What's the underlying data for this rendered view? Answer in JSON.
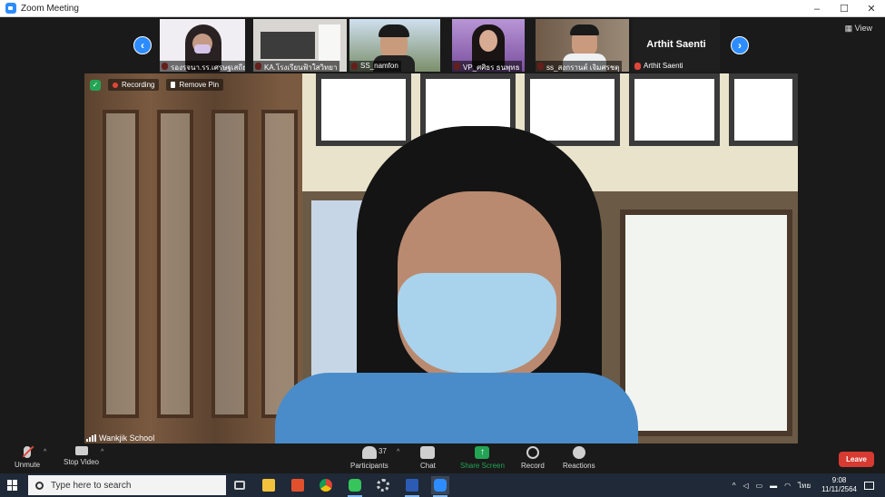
{
  "window": {
    "title": "Zoom Meeting",
    "controls": [
      "–",
      "☐",
      "✕"
    ]
  },
  "gallery": {
    "prev_glyph": "‹",
    "next_glyph": "›",
    "thumbnails": [
      {
        "name": "รองรจนา.รร.เศรษฐเสถียรฯ",
        "bg": "#e8e4ef"
      },
      {
        "name": "KA.โรงเรียนฟ้าใสวิทยา",
        "bg": "#d8d6d2"
      },
      {
        "name": "SS_namfon",
        "bg": "#7b8fa8"
      },
      {
        "name": "VP_ศศิธร ธนพุทธ",
        "bg": "#9d7bb8"
      },
      {
        "name": "ss_สงกรานต์ เจิมศรชตุ",
        "bg": "#6f5a48"
      },
      {
        "name": "Arthit Saenti",
        "bg": "#1f1f1f",
        "big_label": "Arthit Saenti"
      }
    ],
    "view_label": "View"
  },
  "stage": {
    "recording_label": "Recording",
    "remove_pin_label": "Remove Pin",
    "speaker_name": "Wankjik School"
  },
  "toolbar": {
    "unmute": "Unmute",
    "stop_video": "Stop Video",
    "participants": "Participants",
    "participants_count": "37",
    "chat": "Chat",
    "share_screen": "Share Screen",
    "record": "Record",
    "reactions": "Reactions",
    "leave": "Leave"
  },
  "taskbar": {
    "search_placeholder": "Type here to search",
    "apps": [
      {
        "name": "task-view",
        "color": "#cfcfcf"
      },
      {
        "name": "file-explorer",
        "color": "#f2c23d"
      },
      {
        "name": "office",
        "color": "#e0502d"
      },
      {
        "name": "chrome",
        "color": "#3ea34b"
      },
      {
        "name": "line",
        "color": "#36c55a"
      },
      {
        "name": "settings",
        "color": "#cfcfcf"
      },
      {
        "name": "word",
        "color": "#2b5bb5"
      },
      {
        "name": "zoom",
        "color": "#2d8cff"
      }
    ],
    "language": "ไทย",
    "time": "9:08",
    "date": "11/11/2564"
  }
}
